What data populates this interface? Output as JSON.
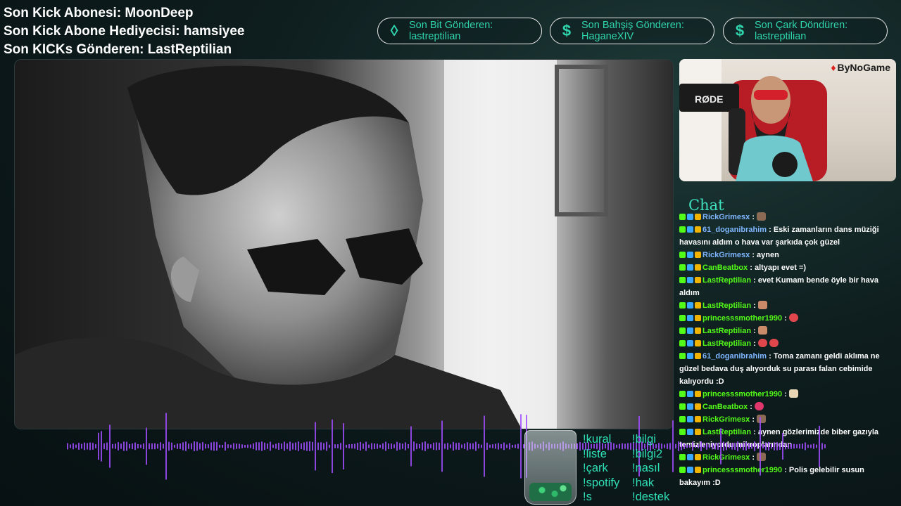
{
  "top_stats": {
    "last_sub": "Son Kick Abonesi: MoonDeep",
    "last_gifter": "Son Kick Abone Hediyecisi: hamsiyee",
    "last_kicks": "Son KICKs Gönderen: LastReptilian"
  },
  "pills": [
    {
      "icon": "◊",
      "label": "Son Bit Gönderen:",
      "value": "lastreptilian"
    },
    {
      "icon": "$",
      "label": "Son Bahşiş Gönderen:",
      "value": "HaganeXIV"
    },
    {
      "icon": "$",
      "label": "Son Çark Döndüren:",
      "value": "lastreptilian"
    }
  ],
  "webcam": {
    "brand": "ByNoGame"
  },
  "chat": {
    "title": "Chat",
    "messages": [
      {
        "user": "RickGrimesx",
        "text": " :",
        "emote": "face",
        "color": "blue"
      },
      {
        "user": "61_doganibrahim",
        "text": " : Eski zamanların dans müziği havasını aldım o hava var şarkıda çok güzel",
        "emote": "",
        "color": "blue"
      },
      {
        "user": "RickGrimesx",
        "text": " : aynen",
        "emote": "",
        "color": "blue"
      },
      {
        "user": "CanBeatbox",
        "text": " : altyapı evet =)",
        "emote": "",
        "color": "green"
      },
      {
        "user": "LastReptilian",
        "text": " : evet Kumam bende öyle bir hava aldım",
        "emote": "",
        "color": "green"
      },
      {
        "user": "LastReptilian",
        "text": " :",
        "emote": "man",
        "color": "green"
      },
      {
        "user": "princesssmother1990",
        "text": " :",
        "emote": "blob",
        "color": "green"
      },
      {
        "user": "LastReptilian",
        "text": " :",
        "emote": "man",
        "color": "green"
      },
      {
        "user": "LastReptilian",
        "text": " :",
        "emote": "blob2",
        "color": "green"
      },
      {
        "user": "61_doganibrahim",
        "text": " : Toma zamanı geldi aklıma ne güzel bedava duş alıyorduk su parası falan cebimide kalıyordu :D",
        "emote": "",
        "color": "blue"
      },
      {
        "user": "princesssmother1990",
        "text": " :",
        "emote": "tag",
        "color": "green"
      },
      {
        "user": "CanBeatbox",
        "text": " :",
        "emote": "pink",
        "color": "green"
      },
      {
        "user": "RickGrimesx",
        "text": " :",
        "emote": "face",
        "color": "green"
      },
      {
        "user": "LastReptilian",
        "text": " : aynen gözlerimizde biber gazıyla temizleniyordu mikroplarından",
        "emote": "",
        "color": "green"
      },
      {
        "user": "RickGrimesx",
        "text": " :",
        "emote": "face",
        "color": "green"
      },
      {
        "user": "princesssmother1990",
        "text": " : Polis gelebilir susun bakayım :D",
        "emote": "",
        "color": "green"
      }
    ]
  },
  "commands_left": [
    "!kural",
    "!liste",
    "!çark",
    "!spotify",
    "!s"
  ],
  "commands_right": [
    "!bilgi",
    "!bilgi2",
    "!nasıl",
    "!hak",
    "!destek"
  ],
  "colors": {
    "accent": "#2fe0b6",
    "kick_green": "#53fc18",
    "wave": "#a04dff"
  }
}
